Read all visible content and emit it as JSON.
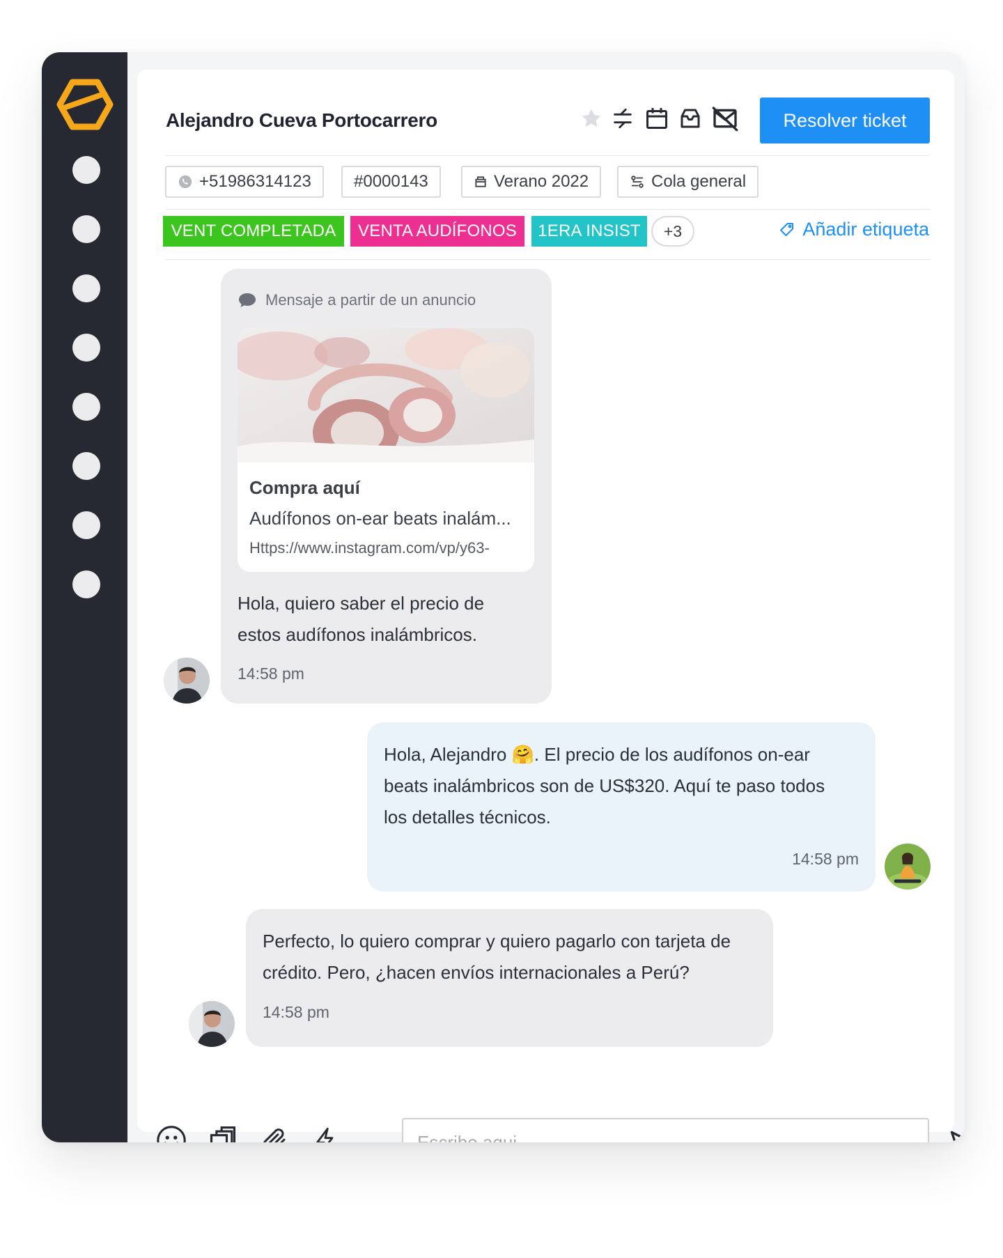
{
  "conversation": {
    "contact_name": "Alejandro Cueva Portocarrero",
    "resolve_button": "Resolver ticket",
    "header_icons": [
      "star-icon",
      "transfer-arrows-icon",
      "calendar-icon",
      "inbox-icon",
      "mail-off-icon"
    ]
  },
  "info_chips": [
    {
      "icon": "whatsapp-icon",
      "label": "+51986314123"
    },
    {
      "icon": "",
      "label": "#0000143"
    },
    {
      "icon": "campaign-icon",
      "label": "Verano 2022"
    },
    {
      "icon": "queue-icon",
      "label": "Cola general"
    }
  ],
  "tags": [
    {
      "label": "VENT COMPLETADA",
      "color": "#3cc51e"
    },
    {
      "label": "VENTA AUDÍFONOS",
      "color": "#ec2f91"
    },
    {
      "label": "1ERA INSIST",
      "color": "#22c4c7"
    }
  ],
  "tags_more": "+3",
  "add_tag_label": "Añadir etiqueta",
  "messages": [
    {
      "direction": "incoming",
      "ad_label": "Mensaje a partir de un anuncio",
      "ad_card": {
        "title": "Compra aquí",
        "description": "Audífonos on-ear beats inalám...",
        "url": "Https://www.instagram.com/vp/y63-"
      },
      "text_lines": [
        "Hola, quiero saber el precio de",
        "estos audífonos inalámbricos."
      ],
      "time": "14:58 pm"
    },
    {
      "direction": "outgoing",
      "text_lines": [
        "Hola, Alejandro 🤗. El precio de los audífonos on-ear",
        "beats inalámbricos son de US$320. Aquí te paso todos",
        "los detalles técnicos."
      ],
      "time": "14:58 pm"
    },
    {
      "direction": "incoming",
      "text_lines": [
        "Perfecto, lo quiero comprar y quiero pagarlo con tarjeta de",
        "crédito. Pero, ¿hacen envíos internacionales a Perú?"
      ],
      "time": "14:58 pm"
    }
  ],
  "composer": {
    "placeholder": "Escribe aqui...",
    "tools": [
      "emoji-icon",
      "copy-icon",
      "attachment-icon",
      "lightning-icon"
    ],
    "send_icon": "send-icon"
  },
  "colors": {
    "sidebar": "#262932",
    "accent": "#1e90f5",
    "logo": "#f6a81a",
    "incoming_bubble": "#ececee",
    "outgoing_bubble": "#eaf2fa"
  }
}
